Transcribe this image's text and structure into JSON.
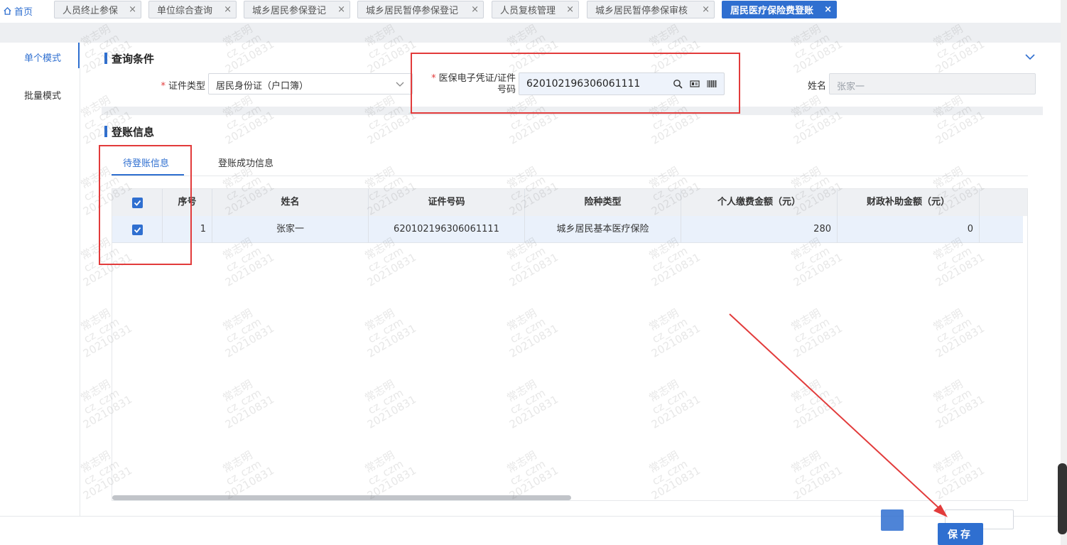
{
  "tabs": {
    "home_label": "首页",
    "items": [
      {
        "label": "人员终止参保"
      },
      {
        "label": "单位综合查询"
      },
      {
        "label": "城乡居民参保登记"
      },
      {
        "label": "城乡居民暂停参保登记"
      },
      {
        "label": "人员复核管理"
      },
      {
        "label": "城乡居民暂停参保审核"
      },
      {
        "label": "居民医疗保险费登账",
        "active": true
      }
    ],
    "close_glyph": "×"
  },
  "modes": {
    "single": "单个模式",
    "batch": "批量模式"
  },
  "query": {
    "title": "查询条件",
    "cert_type_label": "证件类型",
    "cert_type_value": "居民身份证（户口簿）",
    "id_label_line1": "医保电子凭证/证件",
    "id_label_line2": "号码",
    "id_value": "620102196306061111",
    "name_label": "姓名",
    "name_placeholder": "张家一",
    "required_mark": "*"
  },
  "ledger": {
    "title": "登账信息",
    "tabs": [
      "待登账信息",
      "登账成功信息"
    ],
    "columns": [
      "序号",
      "姓名",
      "证件号码",
      "险种类型",
      "个人缴费金额（元）",
      "财政补助金额（元）"
    ],
    "rows": [
      {
        "seq": "1",
        "name": "张家一",
        "id": "620102196306061111",
        "insurance": "城乡居民基本医疗保险",
        "personal": "280",
        "subsidy": "0",
        "checked": true
      }
    ]
  },
  "footer": {
    "save_label": "保存"
  },
  "watermark": {
    "line1": "常志明",
    "line2": "cz_czm",
    "line3": "20210831"
  },
  "colors": {
    "accent": "#2f6fd0",
    "annotation": "#e23b3b"
  },
  "icons": [
    "home-icon",
    "close-icon",
    "chevron-down-icon",
    "search-icon",
    "id-card-icon",
    "barcode-icon",
    "checkbox-icon"
  ]
}
